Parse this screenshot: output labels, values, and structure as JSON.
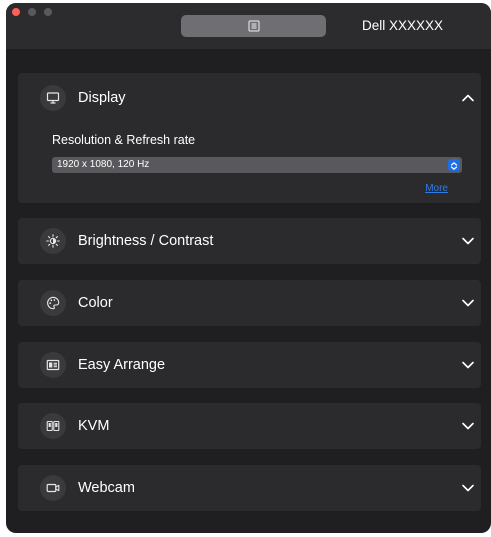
{
  "window": {
    "monitor_name": "Dell XXXXXX",
    "menu_icon": "list-icon"
  },
  "sections": [
    {
      "title": "Display",
      "icon": "monitor-icon",
      "expanded": true,
      "resolution_label": "Resolution & Refresh rate",
      "resolution_value": "1920 x 1080, 120 Hz",
      "more_link": "More"
    },
    {
      "title": "Brightness / Contrast",
      "icon": "brightness-icon",
      "expanded": false
    },
    {
      "title": "Color",
      "icon": "palette-icon",
      "expanded": false
    },
    {
      "title": "Easy Arrange",
      "icon": "layout-icon",
      "expanded": false
    },
    {
      "title": "KVM",
      "icon": "kvm-icon",
      "expanded": false
    },
    {
      "title": "Webcam",
      "icon": "webcam-icon",
      "expanded": false
    }
  ],
  "colors": {
    "window_bg": "#1f1f21",
    "panel_bg": "#2b2b2d",
    "accent": "#1e6fe6",
    "link": "#2f7de8"
  }
}
